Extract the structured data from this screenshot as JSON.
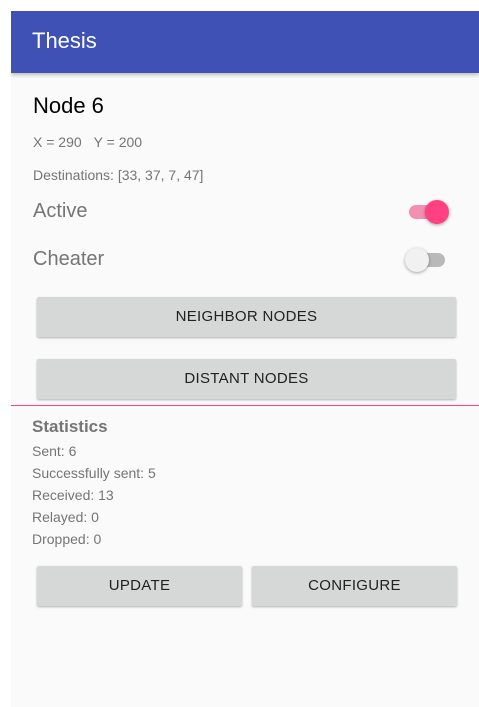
{
  "app_bar": {
    "title": "Thesis",
    "color": "#3f51b5"
  },
  "node": {
    "label": "Node",
    "number": "6",
    "x_text": "X = 290",
    "y_text": "Y = 200",
    "destinations": "Destinations: [33, 37, 7, 47]"
  },
  "switches": {
    "active": {
      "label": "Active",
      "on": true
    },
    "cheater": {
      "label": "Cheater",
      "on": false
    }
  },
  "buttons": {
    "neighbor_nodes": "NEIGHBOR NODES",
    "distant_nodes": "DISTANT NODES",
    "update": "UPDATE",
    "configure": "CONFIGURE"
  },
  "statistics": {
    "heading": "Statistics",
    "sent": "Sent: 6",
    "successfully_sent": "Successfully sent: 5",
    "received": "Received: 13",
    "relayed": "Relayed: 0",
    "dropped": "Dropped: 0"
  },
  "colors": {
    "accent": "#ff4081",
    "primary": "#3f51b5",
    "button": "#d6d7d7"
  }
}
